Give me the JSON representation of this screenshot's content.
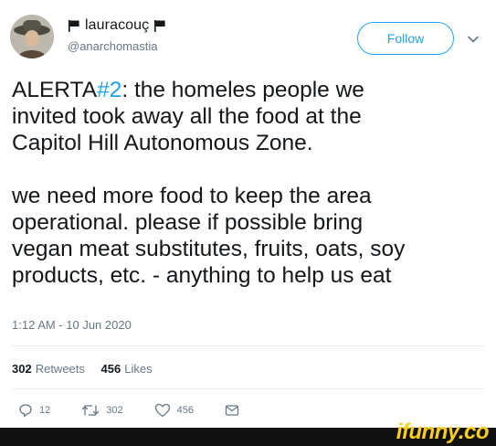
{
  "user": {
    "display_name": "lauracouç",
    "handle": "@anarchomastia",
    "flag_color": "#14171a",
    "avatar_icon": "avatar-photo"
  },
  "follow_label": "Follow",
  "tweet": {
    "line1_hashtag": "#2",
    "line1_prefix": "ALERTA",
    "line1_rest": ": the homeles people we",
    "lines_a": [
      "invited took away all the food at the",
      "Capitol Hill Autonomous Zone."
    ],
    "lines_b": [
      "we need more food to keep the area",
      "operational. please if possible bring",
      "vegan meat substitutes, fruits, oats, soy",
      "products, etc. - anything to help us eat"
    ]
  },
  "timestamp": "1:12 AM - 10 Jun 2020",
  "stats": {
    "retweets_count": "302",
    "retweets_label": "Retweets",
    "likes_count": "456",
    "likes_label": "Likes"
  },
  "actions": {
    "reply_count": "12",
    "retweet_count": "302",
    "like_count": "456"
  },
  "watermark": "ifunny.co",
  "colors": {
    "accent": "#1da1f2",
    "text": "#14171a",
    "muted": "#657786",
    "watermark": "#fccd1a"
  }
}
